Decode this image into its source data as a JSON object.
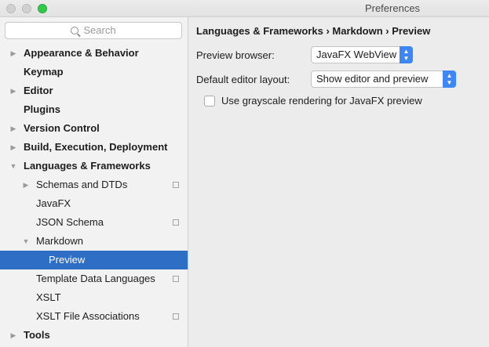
{
  "window": {
    "title": "Preferences"
  },
  "search": {
    "placeholder": "Search"
  },
  "sidebar": {
    "items": [
      {
        "label": "Appearance & Behavior",
        "arrow": "▶"
      },
      {
        "label": "Keymap",
        "arrow": ""
      },
      {
        "label": "Editor",
        "arrow": "▶"
      },
      {
        "label": "Plugins",
        "arrow": ""
      },
      {
        "label": "Version Control",
        "arrow": "▶"
      },
      {
        "label": "Build, Execution, Deployment",
        "arrow": "▶"
      },
      {
        "label": "Languages & Frameworks",
        "arrow": "▼"
      },
      {
        "label": "Schemas and DTDs",
        "arrow": "▶"
      },
      {
        "label": "JavaFX",
        "arrow": ""
      },
      {
        "label": "JSON Schema",
        "arrow": ""
      },
      {
        "label": "Markdown",
        "arrow": "▼"
      },
      {
        "label": "Preview",
        "arrow": ""
      },
      {
        "label": "Template Data Languages",
        "arrow": ""
      },
      {
        "label": "XSLT",
        "arrow": ""
      },
      {
        "label": "XSLT File Associations",
        "arrow": ""
      },
      {
        "label": "Tools",
        "arrow": "▶"
      }
    ]
  },
  "content": {
    "breadcrumb": "Languages & Frameworks › Markdown › Preview",
    "preview_browser_label": "Preview browser:",
    "preview_browser_value": "JavaFX WebView",
    "layout_label": "Default editor layout:",
    "layout_value": "Show editor and preview",
    "grayscale_label": "Use grayscale rendering for JavaFX preview",
    "grayscale_checked": false
  },
  "colors": {
    "selection": "#2f6ec5",
    "select_button": "#3d86f3"
  }
}
